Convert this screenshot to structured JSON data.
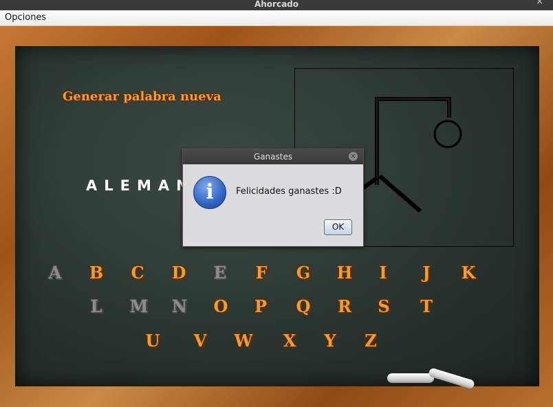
{
  "window": {
    "title": "Ahorcado",
    "close_glyph": "×"
  },
  "menubar": {
    "items": [
      "Opciones"
    ]
  },
  "game": {
    "generate_label": "Generar palabra nueva",
    "word_display": "ALEMAN",
    "letters_row1": [
      {
        "l": "A",
        "used": true
      },
      {
        "l": "B",
        "used": false
      },
      {
        "l": "C",
        "used": false
      },
      {
        "l": "D",
        "used": false
      },
      {
        "l": "E",
        "used": true
      },
      {
        "l": "F",
        "used": false
      },
      {
        "l": "G",
        "used": false
      },
      {
        "l": "H",
        "used": false
      },
      {
        "l": "I",
        "used": false
      },
      {
        "l": "J",
        "used": false
      },
      {
        "l": "K",
        "used": false
      }
    ],
    "letters_row2": [
      {
        "l": "L",
        "used": true
      },
      {
        "l": "M",
        "used": true
      },
      {
        "l": "N",
        "used": true
      },
      {
        "l": "O",
        "used": false
      },
      {
        "l": "P",
        "used": false
      },
      {
        "l": "Q",
        "used": false
      },
      {
        "l": "R",
        "used": false
      },
      {
        "l": "S",
        "used": false
      },
      {
        "l": "T",
        "used": false
      }
    ],
    "letters_row3": [
      {
        "l": "U",
        "used": false
      },
      {
        "l": "V",
        "used": false
      },
      {
        "l": "W",
        "used": false
      },
      {
        "l": "X",
        "used": false
      },
      {
        "l": "Y",
        "used": false
      },
      {
        "l": "Z",
        "used": false
      }
    ]
  },
  "dialog": {
    "title": "Ganastes",
    "close_glyph": "×",
    "icon_glyph": "i",
    "message": "Felicidades ganastes :D",
    "ok_label": "OK"
  },
  "colors": {
    "letter_active": "#f59b30",
    "letter_used": "#8c8c8c",
    "board": "#2a3530",
    "frame": "#b8702e"
  }
}
